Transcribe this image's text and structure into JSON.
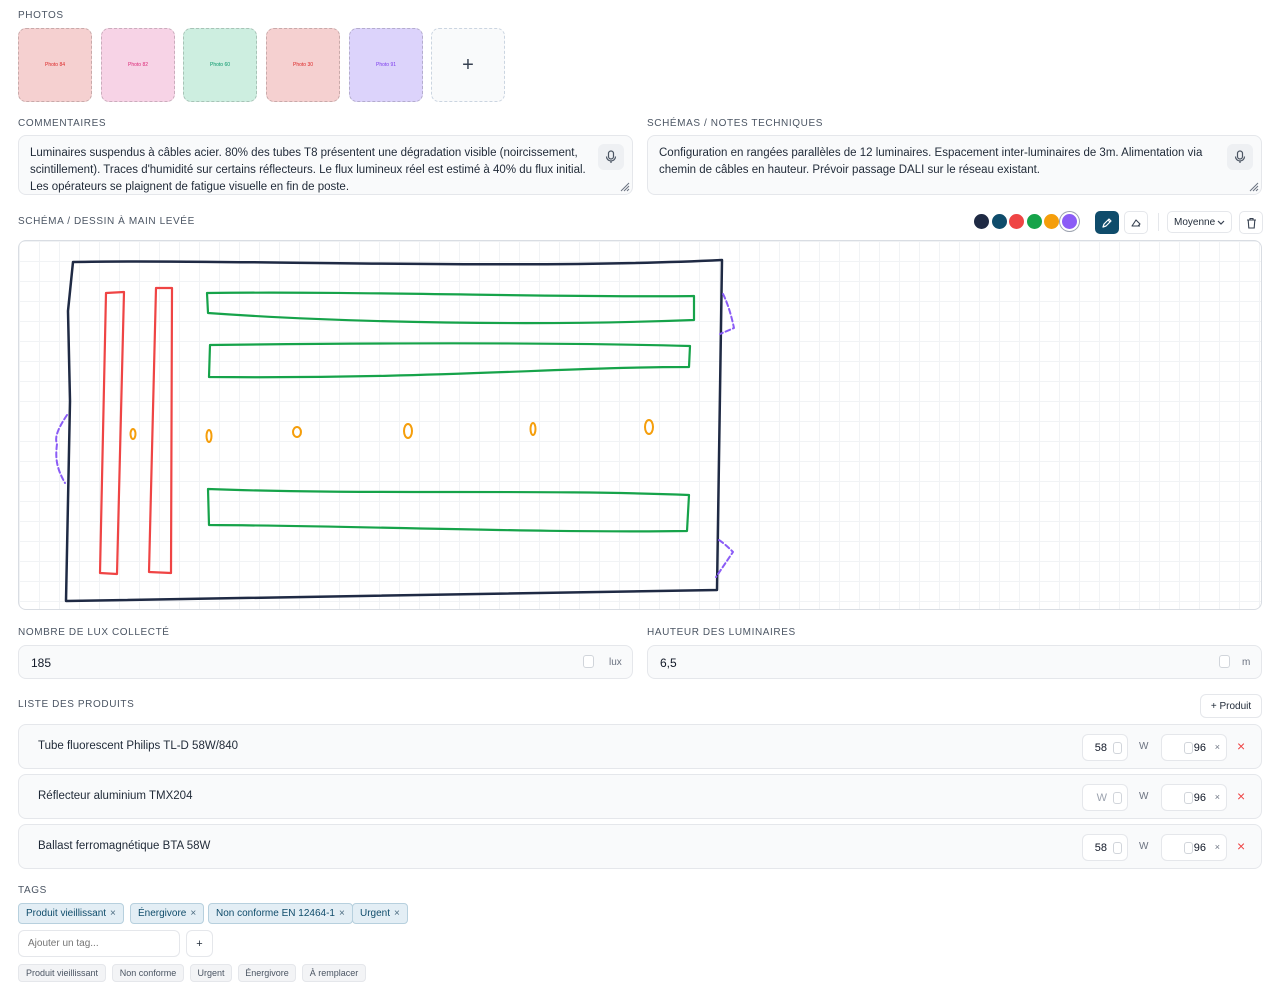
{
  "photos": {
    "label": "PHOTOS",
    "items": [
      {
        "label": "Photo 84",
        "bg": "#f5d0d0",
        "fg": "#dc2626"
      },
      {
        "label": "Photo 82",
        "bg": "#f7d3e6",
        "fg": "#db2777"
      },
      {
        "label": "Photo 60",
        "bg": "#cdeee0",
        "fg": "#059669"
      },
      {
        "label": "Photo 30",
        "bg": "#f5d0d0",
        "fg": "#dc2626"
      },
      {
        "label": "Photo 91",
        "bg": "#dcd3fb",
        "fg": "#7c3aed"
      }
    ],
    "add_label": "+"
  },
  "comments": {
    "label": "COMMENTAIRES",
    "text": "Luminaires suspendus à câbles acier. 80% des tubes T8 présentent une dégradation visible (noircissement, scintillement). Traces d'humidité sur certains réflecteurs. Le flux lumineux réel est estimé à 40% du flux initial. Les opérateurs se plaignent de fatigue visuelle en fin de poste."
  },
  "schemas_notes": {
    "label": "SCHÉMAS / NOTES TECHNIQUES",
    "text": "Configuration en rangées parallèles de 12 luminaires. Espacement inter-luminaires de 3m. Alimentation via chemin de câbles en hauteur. Prévoir passage DALI sur le réseau existant."
  },
  "drawing": {
    "label": "SCHÉMA / DESSIN À MAIN LEVÉE",
    "colors": [
      "#1f2a44",
      "#0f4c6b",
      "#ef4444",
      "#16a34a",
      "#f59e0b",
      "#8b5cf6"
    ],
    "selected_color": "#8b5cf6",
    "thickness": "Moyenne",
    "accent": "#0f4c6b",
    "pen_icon": "pen-icon",
    "eraser_icon": "eraser-icon",
    "trash_icon": "trash-icon"
  },
  "lux": {
    "label": "NOMBRE DE LUX COLLECTÉ",
    "value": "185",
    "unit": "lux"
  },
  "hauteur": {
    "label": "HAUTEUR DES LUMINAIRES",
    "value": "6,5",
    "unit": "m"
  },
  "products": {
    "label": "LISTE DES PRODUITS",
    "add_label": "+ Produit",
    "power_unit": "W",
    "times": "×",
    "delete": "×",
    "items": [
      {
        "name": "Tube fluorescent Philips TL-D 58W/840",
        "power": "58",
        "power_placeholder": "",
        "qty": "96"
      },
      {
        "name": "Réflecteur aluminium TMX204",
        "power": "",
        "power_placeholder": "W",
        "qty": "96"
      },
      {
        "name": "Ballast ferromagnétique BTA 58W",
        "power": "58",
        "power_placeholder": "",
        "qty": "96"
      }
    ]
  },
  "tags": {
    "label": "TAGS",
    "items": [
      "Produit vieillissant",
      "Énergivore",
      "Non conforme EN 12464-1",
      "Urgent"
    ],
    "remove": "×",
    "input_placeholder": "Ajouter un tag...",
    "add_button": "+",
    "suggestions": [
      "Produit vieillissant",
      "Non conforme",
      "Urgent",
      "Énergivore",
      "À remplacer"
    ]
  }
}
